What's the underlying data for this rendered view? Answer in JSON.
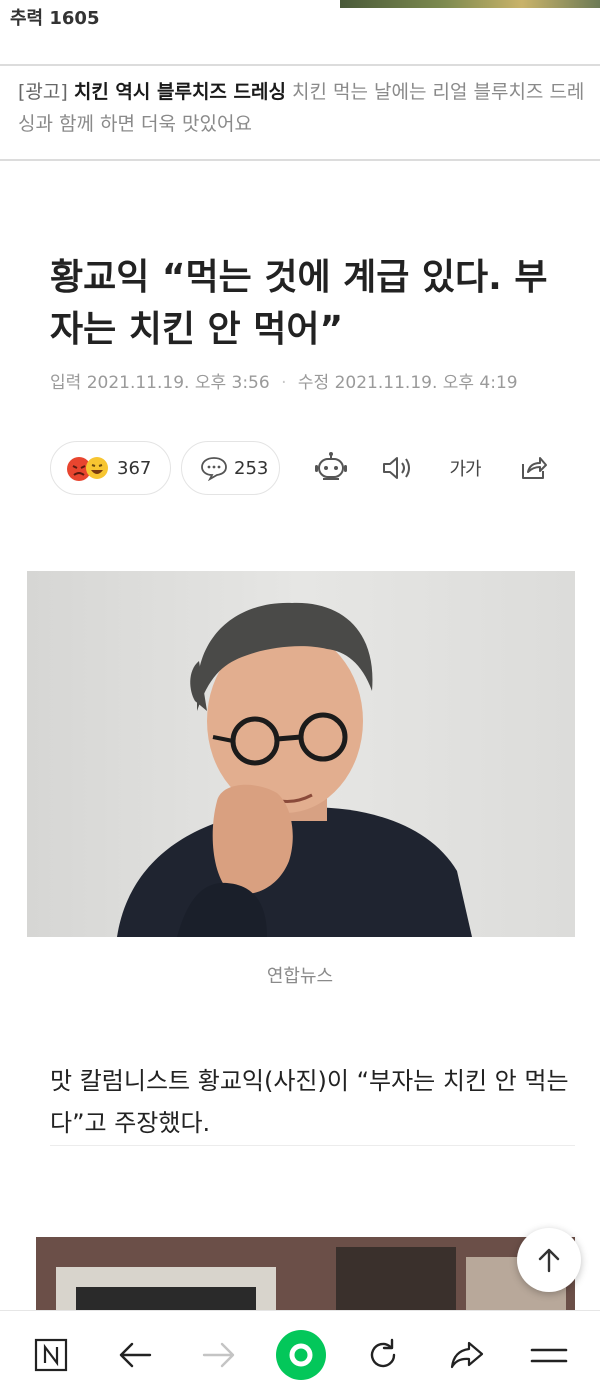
{
  "topbar": {
    "meta": "추력 1605"
  },
  "ad": {
    "tag": "[광고]",
    "title": "치킨 역시 블루치즈 드레싱",
    "body": "치킨 먹는 날에는 리얼 블루치즈 드레싱과 함께 하면 더욱 맛있어요"
  },
  "article": {
    "headline": "황교익 “먹는 것에 계급 있다. 부자는 치킨 안 먹어”",
    "published_label": "입력",
    "published": "2021.11.19. 오후 3:56",
    "modified_label": "수정",
    "modified": "2021.11.19. 오후 4:19",
    "photo_caption": "연합뉴스",
    "body": "맛 칼럼니스트 황교익(사진)이 “부자는 치킨 안 먹는다”고 주장했다."
  },
  "actions": {
    "reaction_count": "367",
    "comment_count": "253",
    "font_size_label": "가가"
  },
  "icons": {
    "reactions": "angry-laugh-emoji-icon",
    "comment": "speech-bubble-icon",
    "robot": "robot-summary-icon",
    "speaker": "speaker-icon",
    "share": "share-icon",
    "scroll_top": "arrow-up-icon",
    "nav_home": "n-home-icon",
    "nav_back": "arrow-left-icon",
    "nav_forward": "arrow-right-icon",
    "nav_green": "green-circle-icon",
    "nav_refresh": "refresh-icon",
    "nav_share": "share-arrow-icon",
    "nav_menu": "menu-icon"
  },
  "colors": {
    "accent": "#03c75a",
    "muted": "#8a8a8a",
    "text": "#1a1a1a"
  }
}
